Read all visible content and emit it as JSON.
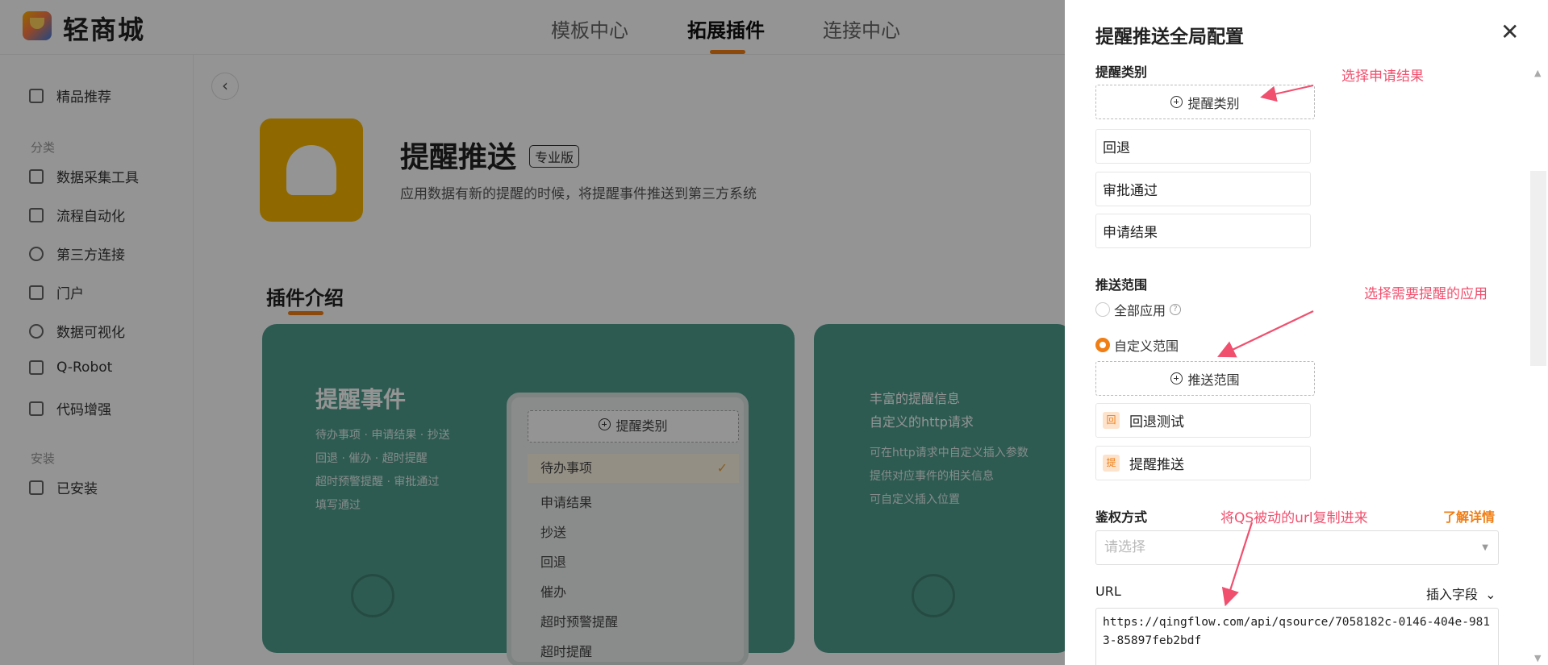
{
  "app": {
    "brand": "轻商城"
  },
  "top_nav": [
    {
      "label": "模板中心"
    },
    {
      "label": "拓展插件"
    },
    {
      "label": "连接中心"
    }
  ],
  "sidebar": {
    "featured": "精品推荐",
    "section_category": "分类",
    "items": [
      "数据采集工具",
      "流程自动化",
      "第三方连接",
      "门户",
      "数据可视化",
      "Q-Robot",
      "代码增强"
    ],
    "section_install": "安装",
    "installed": "已安装"
  },
  "plugin": {
    "title": "提醒推送",
    "badge": "专业版",
    "description": "应用数据有新的提醒的时候，将提醒事件推送到第三方系统",
    "intro_heading": "插件介绍"
  },
  "card1": {
    "heading": "提醒事件",
    "lines": [
      "待办事项 · 申请结果 · 抄送",
      "回退 · 催办 · 超时提醒",
      "超时预警提醒 · 审批通过",
      "填写通过"
    ],
    "phone_button": "提醒类别",
    "phone_items": [
      "待办事项",
      "申请结果",
      "抄送",
      "回退",
      "催办",
      "超时预警提醒",
      "超时提醒"
    ]
  },
  "card2": {
    "headline1": "丰富的提醒信息",
    "headline2": "自定义的http请求",
    "lines": [
      "可在http请求中自定义插入参数",
      "提供对应事件的相关信息",
      "可自定义插入位置"
    ]
  },
  "drawer": {
    "title": "提醒推送全局配置",
    "reminder_type": {
      "label": "提醒类别",
      "add_button": "提醒类别",
      "items": [
        "回退",
        "审批通过",
        "申请结果"
      ]
    },
    "push_scope": {
      "label": "推送范围",
      "option_all": "全部应用",
      "option_custom": "自定义范围",
      "add_button": "推送范围",
      "apps": [
        {
          "icon": "回",
          "name": "回退测试"
        },
        {
          "icon": "提",
          "name": "提醒推送"
        }
      ]
    },
    "auth": {
      "label": "鉴权方式",
      "learn_more": "了解详情",
      "placeholder": "请选择"
    },
    "url": {
      "label": "URL",
      "insert_field": "插入字段",
      "value": "https://qingflow.com/api/qsource/7058182c-0146-404e-9813-85897feb2bdf"
    },
    "annotations": {
      "a1": "选择申请结果",
      "a2": "选择需要提醒的应用",
      "a3": "将QS被动的url复制进来"
    }
  },
  "colors": {
    "accent": "#f07e15",
    "annotation": "#f0506e",
    "card": "#4f9d8c",
    "plugin_icon": "#f7b500"
  }
}
